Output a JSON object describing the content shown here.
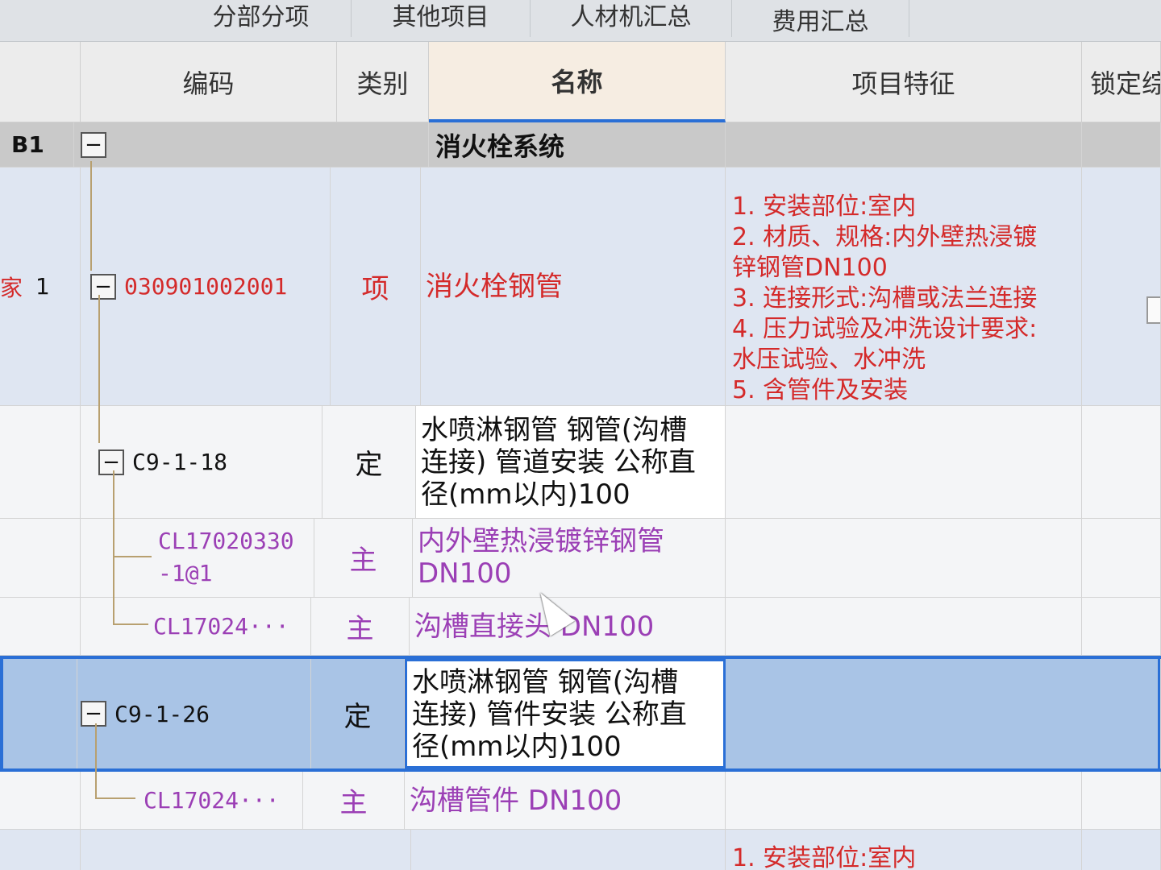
{
  "tabs": [
    "分部分项",
    "其他项目",
    "人材机汇总",
    "费用汇总"
  ],
  "headers": {
    "code": "编码",
    "type": "类别",
    "name": "名称",
    "feature": "项目特征",
    "lock": "锁定综合单价"
  },
  "rows": {
    "group": {
      "seq": "B1",
      "toggle": "−",
      "name": "消火栓系统"
    },
    "item": {
      "seq_prefix": "家",
      "seq": "1",
      "toggle": "−",
      "code": "030901002001",
      "type": "项",
      "name": "消火栓钢管",
      "features": [
        "1. 安装部位:室内",
        "2. 材质、规格:内外壁热浸镀",
        "锌钢管DN100",
        "3. 连接形式:沟槽或法兰连接",
        "4. 压力试验及冲洗设计要求:",
        "水压试验、水冲洗",
        "5. 含管件及安装"
      ]
    },
    "def1": {
      "toggle": "−",
      "code": "C9-1-18",
      "type": "定",
      "name_lines": [
        "水喷淋钢管 钢管(沟槽",
        "连接) 管道安装 公称直",
        "径(mm以内)100"
      ]
    },
    "main1": {
      "code_lines": [
        "CL17020330",
        "-1@1"
      ],
      "type": "主",
      "name_lines": [
        "内外壁热浸镀锌钢管",
        "DN100"
      ]
    },
    "main2": {
      "code": "CL17024···",
      "type": "主",
      "name": "沟槽直接头 DN100"
    },
    "def2": {
      "toggle": "−",
      "code": "C9-1-26",
      "type": "定",
      "name_lines": [
        "水喷淋钢管 钢管(沟槽",
        "连接) 管件安装 公称直",
        "径(mm以内)100"
      ]
    },
    "main3": {
      "code": "CL17024···",
      "type": "主",
      "name": "沟槽管件 DN100"
    },
    "next": {
      "feature": "1. 安装部位:室内"
    }
  },
  "colors": {
    "item_text": "#d42a2a",
    "material_text": "#9b3fb5",
    "selection_border": "#2a6fd6",
    "group_bg": "#c9c9c9"
  }
}
